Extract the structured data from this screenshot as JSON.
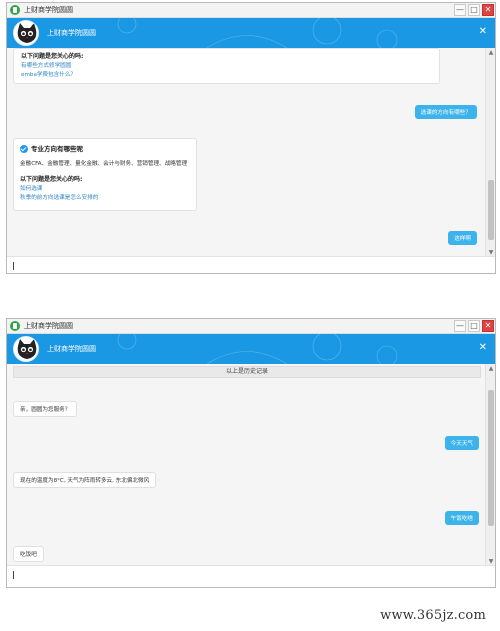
{
  "window_title": "上财商学院圆圆",
  "header": {
    "title": "上财商学院圆圆",
    "close_symbol": "✕"
  },
  "window_buttons": {
    "min": "—",
    "max": "□",
    "close": "✕"
  },
  "scrollbar": {
    "up": "▲",
    "down": "▼"
  },
  "screen1": {
    "card1": {
      "heading": "以下问题是您关心的吗:",
      "links": [
        "有哪些方式修学圆圆",
        "emba学费包含什么？"
      ]
    },
    "user_msg1": "选课的方向有哪些？",
    "card2": {
      "title": "专业方向有哪些呢",
      "body": "金融CFA、金融管理、量化金融、会计与财务、营销管理、战略管理",
      "heading": "以下问题是您关心的吗:",
      "links": [
        "如何选课",
        "秋季的前方向选课是怎么安排的"
      ]
    },
    "user_msg2": "这样啊"
  },
  "screen2": {
    "history_label": "以上是历史记录",
    "bot_msg1": "亲，圆圆为您服务？",
    "user_msg1": "今天天气",
    "bot_msg2": "现在的温度为8°C, 天气为阵雨转多云, 东北偏北微风",
    "user_msg2": "午饭吃啥",
    "bot_msg3": "吃饭吧"
  },
  "watermark": "www.365jz.com",
  "colors": {
    "header": "#1a98e3",
    "user_bubble": "#3db3ec",
    "link": "#2e84c9"
  },
  "icons": {
    "app": "app-icon",
    "avatar": "cat-avatar-icon",
    "check": "check-circle-icon"
  }
}
